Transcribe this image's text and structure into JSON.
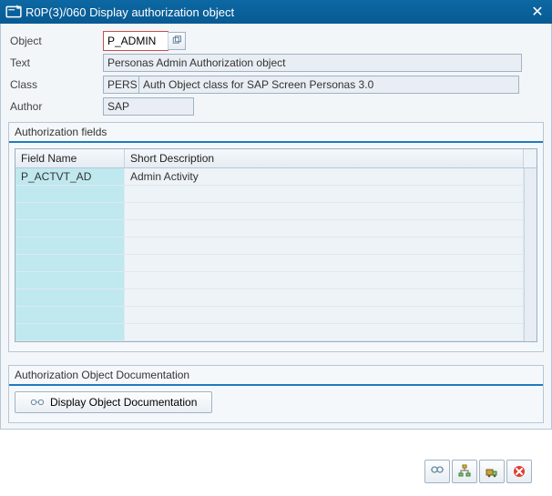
{
  "window": {
    "title": "R0P(3)/060 Display authorization object"
  },
  "form": {
    "object_label": "Object",
    "object_value": "P_ADMIN",
    "text_label": "Text",
    "text_value": "Personas Admin Authorization object",
    "class_label": "Class",
    "class_code": "PERS",
    "class_text": "Auth Object class for SAP Screen Personas 3.0",
    "author_label": "Author",
    "author_value": "SAP"
  },
  "fields_group": {
    "title": "Authorization fields",
    "columns": {
      "field_name": "Field Name",
      "short_desc": "Short Description"
    },
    "rows": [
      {
        "field": "P_ACTVT_AD",
        "desc": "Admin Activity"
      },
      {
        "field": "",
        "desc": ""
      },
      {
        "field": "",
        "desc": ""
      },
      {
        "field": "",
        "desc": ""
      },
      {
        "field": "",
        "desc": ""
      },
      {
        "field": "",
        "desc": ""
      },
      {
        "field": "",
        "desc": ""
      },
      {
        "field": "",
        "desc": ""
      },
      {
        "field": "",
        "desc": ""
      },
      {
        "field": "",
        "desc": ""
      }
    ]
  },
  "doc_group": {
    "title": "Authorization Object Documentation",
    "button_label": "Display Object Documentation"
  },
  "colors": {
    "accent": "#0d68a3",
    "hair": "#b5c7d7"
  }
}
